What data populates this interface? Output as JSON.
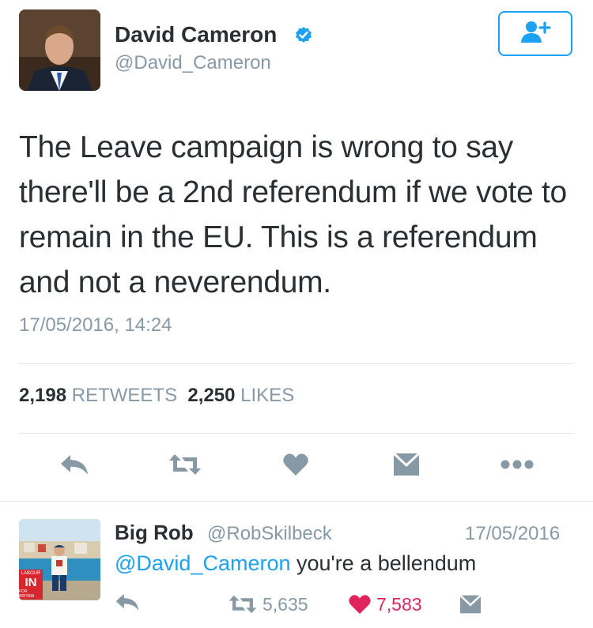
{
  "tweet": {
    "author_name": "David Cameron",
    "author_handle": "@David_Cameron",
    "text": "The Leave campaign is wrong to say there'll be a 2nd referendum if we vote to remain in the EU. This is a referendum and not a neverendum.",
    "timestamp": "17/05/2016, 14:24",
    "retweet_count": "2,198",
    "retweet_label": "RETWEETS",
    "like_count": "2,250",
    "like_label": "LIKES"
  },
  "reply": {
    "author_name": "Big Rob",
    "author_handle": "@RobSkilbeck",
    "date": "17/05/2016",
    "mention": "@David_Cameron",
    "text": " you're a bellendum",
    "retweet_count": "5,635",
    "like_count": "7,583",
    "avatar_badge_top": "LABOUR",
    "avatar_badge_main": "IN",
    "avatar_badge_bottom": "FOR BRITAIN"
  },
  "icons": {
    "verified": "verified-badge-icon",
    "follow": "add-user-icon",
    "reply": "reply-icon",
    "retweet": "retweet-icon",
    "like": "heart-icon",
    "dm": "envelope-icon",
    "more": "more-dots-icon"
  },
  "colors": {
    "accent": "#1da1f2",
    "muted": "#8899a6",
    "icon": "#8899a6",
    "liked": "#e0245e",
    "text": "#292f33"
  }
}
